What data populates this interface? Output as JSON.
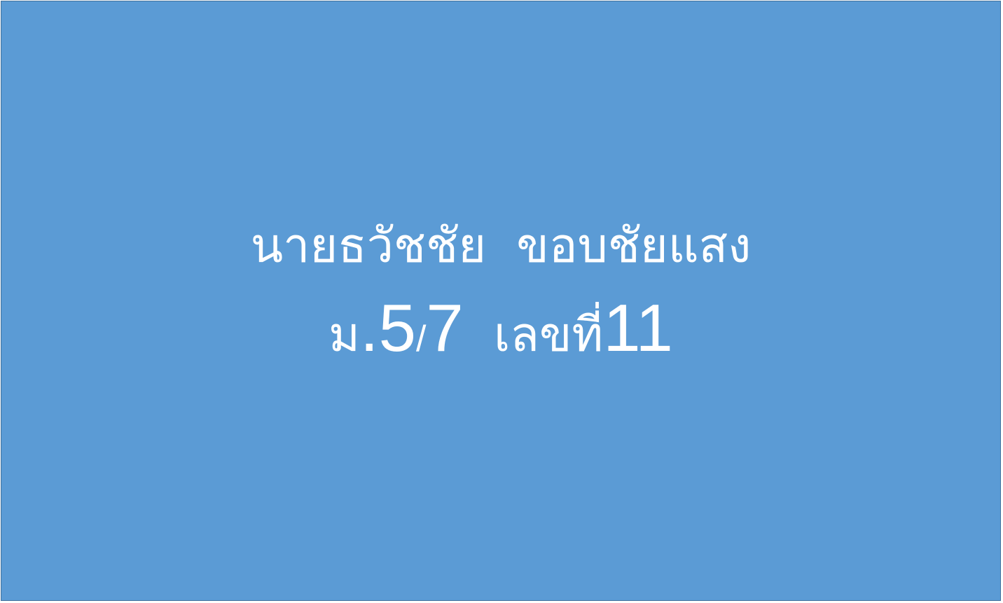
{
  "slide": {
    "background_color": "#5b9bd5",
    "text_color": "#ffffff",
    "name_line": "นายธวัชชัย  ขอบชัยแสง",
    "class_prefix": "ม",
    "class_dot": ".",
    "class_grade": "5",
    "class_slash": "/",
    "class_room": "7",
    "gap": "  ",
    "number_label": "เลขที่",
    "number_value": "11"
  }
}
